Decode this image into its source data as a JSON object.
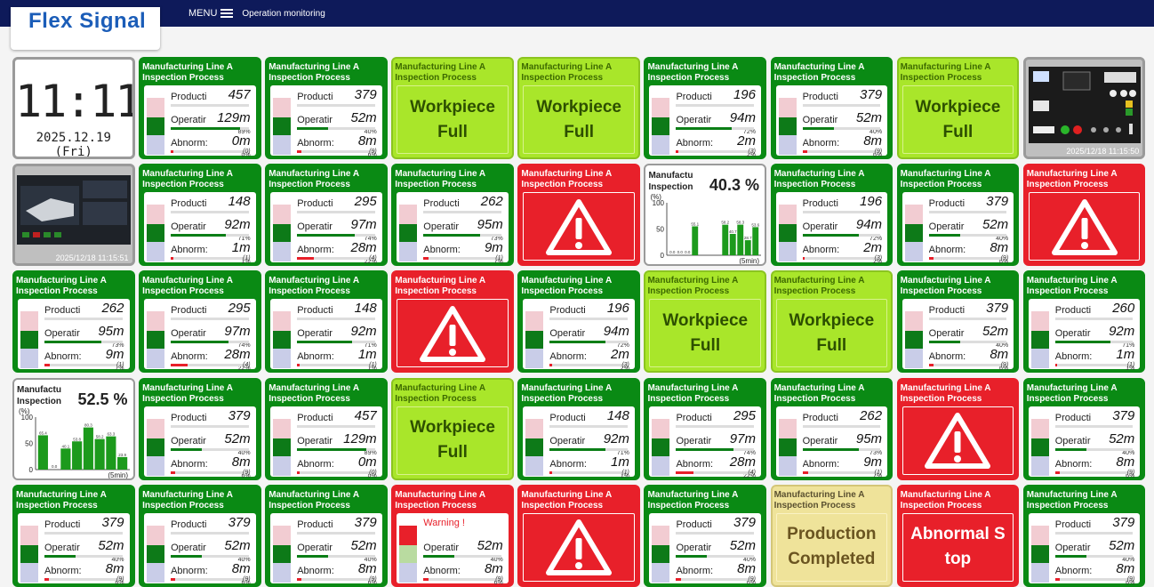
{
  "app": {
    "logo": "Flex Signal",
    "menu_label": "MENU",
    "breadcrumb": "Operation monitoring"
  },
  "clock": {
    "time": "11:11",
    "date": "2025.12.19 (Fri)"
  },
  "header": {
    "line1": "Manufacturing Line A",
    "line2": "Inspection Process"
  },
  "labels": {
    "production": "Producti",
    "operation": "Operatir",
    "abnormal": "Abnorm:",
    "warning": "Warning !"
  },
  "colors": {
    "green": "#0a8a14",
    "lime": "#a9e62a",
    "red": "#e8202a",
    "cream": "#efe39a",
    "navy": "#0e1a5a"
  },
  "tiles": [
    {
      "type": "clock"
    },
    {
      "type": "metric",
      "prod": "457",
      "op": "129m",
      "op_pct": "89%",
      "ab": "0m",
      "ab_pct": "0%",
      "count": "(0)",
      "op_fill": 0.89,
      "ab_fill": 0.0
    },
    {
      "type": "metric",
      "prod": "379",
      "op": "52m",
      "op_pct": "40%",
      "ab": "8m",
      "ab_pct": "6%",
      "count": "(9)",
      "op_fill": 0.4,
      "ab_fill": 0.06
    },
    {
      "type": "message",
      "color": "lime",
      "text": "Workpiece Full"
    },
    {
      "type": "message",
      "color": "lime",
      "text": "Workpiece Full"
    },
    {
      "type": "metric",
      "prod": "196",
      "op": "94m",
      "op_pct": "72%",
      "ab": "2m",
      "ab_pct": "2%",
      "count": "(3)",
      "op_fill": 0.72,
      "ab_fill": 0.02
    },
    {
      "type": "metric",
      "prod": "379",
      "op": "52m",
      "op_pct": "40%",
      "ab": "8m",
      "ab_pct": "6%",
      "count": "(9)",
      "op_fill": 0.4,
      "ab_fill": 0.06
    },
    {
      "type": "message",
      "color": "lime",
      "text": "Workpiece Full"
    },
    {
      "type": "image",
      "icon": "control-panel-image",
      "stamp": "2025/12/18 11:15:50"
    },
    {
      "type": "image",
      "icon": "machine-monitor-image",
      "stamp": "2025/12/18 11:15:51"
    },
    {
      "type": "metric",
      "prod": "148",
      "op": "92m",
      "op_pct": "71%",
      "ab": "1m",
      "ab_pct": "1%",
      "count": "(1)",
      "op_fill": 0.71,
      "ab_fill": 0.01
    },
    {
      "type": "metric",
      "prod": "295",
      "op": "97m",
      "op_pct": "74%",
      "ab": "28m",
      "ab_pct": "22%",
      "count": "(4)",
      "op_fill": 0.74,
      "ab_fill": 0.22
    },
    {
      "type": "metric",
      "prod": "262",
      "op": "95m",
      "op_pct": "73%",
      "ab": "9m",
      "ab_pct": "7%",
      "count": "(1)",
      "op_fill": 0.73,
      "ab_fill": 0.07
    },
    {
      "type": "alert"
    },
    {
      "type": "chart",
      "title": "Manufactu\nInspection",
      "big": "40.3 %",
      "unit": "(%)",
      "interval": "(5min)",
      "ymax": "100",
      "ymid": "50",
      "ymin": "0",
      "bars": [
        0,
        0,
        0,
        55.1,
        0,
        0,
        0,
        58.2,
        40.7,
        58.3,
        28.7,
        53.6
      ],
      "bar_labels": [
        "0.0",
        "0.0",
        "0.0",
        "55.1",
        "",
        "",
        "",
        "58.2",
        "40.7",
        "58.3",
        "28.7",
        "53.6"
      ]
    },
    {
      "type": "metric",
      "prod": "196",
      "op": "94m",
      "op_pct": "72%",
      "ab": "2m",
      "ab_pct": "2%",
      "count": "(3)",
      "op_fill": 0.72,
      "ab_fill": 0.02
    },
    {
      "type": "metric",
      "prod": "379",
      "op": "52m",
      "op_pct": "40%",
      "ab": "8m",
      "ab_pct": "6%",
      "count": "(9)",
      "op_fill": 0.4,
      "ab_fill": 0.06
    },
    {
      "type": "alert"
    },
    {
      "type": "metric",
      "prod": "262",
      "op": "95m",
      "op_pct": "73%",
      "ab": "9m",
      "ab_pct": "7%",
      "count": "(1)",
      "op_fill": 0.73,
      "ab_fill": 0.07
    },
    {
      "type": "metric",
      "prod": "295",
      "op": "97m",
      "op_pct": "74%",
      "ab": "28m",
      "ab_pct": "22%",
      "count": "(4)",
      "op_fill": 0.74,
      "ab_fill": 0.22
    },
    {
      "type": "metric",
      "prod": "148",
      "op": "92m",
      "op_pct": "71%",
      "ab": "1m",
      "ab_pct": "1%",
      "count": "(1)",
      "op_fill": 0.71,
      "ab_fill": 0.01
    },
    {
      "type": "alert"
    },
    {
      "type": "metric",
      "prod": "196",
      "op": "94m",
      "op_pct": "72%",
      "ab": "2m",
      "ab_pct": "2%",
      "count": "(3)",
      "op_fill": 0.72,
      "ab_fill": 0.02
    },
    {
      "type": "message",
      "color": "lime",
      "text": "Workpiece Full"
    },
    {
      "type": "message",
      "color": "lime",
      "text": "Workpiece Full"
    },
    {
      "type": "metric",
      "prod": "379",
      "op": "52m",
      "op_pct": "40%",
      "ab": "8m",
      "ab_pct": "6%",
      "count": "(9)",
      "op_fill": 0.4,
      "ab_fill": 0.06
    },
    {
      "type": "metric",
      "prod": "260",
      "op": "92m",
      "op_pct": "71%",
      "ab": "1m",
      "ab_pct": "1%",
      "count": "(1)",
      "op_fill": 0.71,
      "ab_fill": 0.01
    },
    {
      "type": "chart",
      "title": "Manufactu\nInspection",
      "big": "52.5 %",
      "unit": "(%)",
      "interval": "(5min)",
      "ymax": "100",
      "ymid": "50",
      "ymin": "0",
      "bars": [
        65.4,
        0,
        40.1,
        53.8,
        80.3,
        58.2,
        63.3,
        23.9
      ],
      "bar_labels": [
        "65.4",
        "0.0",
        "40.1",
        "53.8",
        "80.3",
        "58.2",
        "63.3",
        "23.9"
      ]
    },
    {
      "type": "metric",
      "prod": "379",
      "op": "52m",
      "op_pct": "40%",
      "ab": "8m",
      "ab_pct": "6%",
      "count": "(9)",
      "op_fill": 0.4,
      "ab_fill": 0.06
    },
    {
      "type": "metric",
      "prod": "457",
      "op": "129m",
      "op_pct": "89%",
      "ab": "0m",
      "ab_pct": "0%",
      "count": "(0)",
      "op_fill": 0.89,
      "ab_fill": 0.0
    },
    {
      "type": "message",
      "color": "lime",
      "text": "Workpiece Full"
    },
    {
      "type": "metric",
      "prod": "148",
      "op": "92m",
      "op_pct": "71%",
      "ab": "1m",
      "ab_pct": "1%",
      "count": "(1)",
      "op_fill": 0.71,
      "ab_fill": 0.01
    },
    {
      "type": "metric",
      "prod": "295",
      "op": "97m",
      "op_pct": "74%",
      "ab": "28m",
      "ab_pct": "22%",
      "count": "(4)",
      "op_fill": 0.74,
      "ab_fill": 0.22
    },
    {
      "type": "metric",
      "prod": "262",
      "op": "95m",
      "op_pct": "73%",
      "ab": "9m",
      "ab_pct": "7%",
      "count": "(1)",
      "op_fill": 0.73,
      "ab_fill": 0.07
    },
    {
      "type": "alert"
    },
    {
      "type": "metric",
      "prod": "379",
      "op": "52m",
      "op_pct": "40%",
      "ab": "8m",
      "ab_pct": "6%",
      "count": "(9)",
      "op_fill": 0.4,
      "ab_fill": 0.06
    },
    {
      "type": "metric",
      "prod": "379",
      "op": "52m",
      "op_pct": "40%",
      "ab": "8m",
      "ab_pct": "6%",
      "count": "(9)",
      "op_fill": 0.4,
      "ab_fill": 0.06
    },
    {
      "type": "metric",
      "prod": "379",
      "op": "52m",
      "op_pct": "40%",
      "ab": "8m",
      "ab_pct": "6%",
      "count": "(9)",
      "op_fill": 0.4,
      "ab_fill": 0.06
    },
    {
      "type": "metric",
      "prod": "379",
      "op": "52m",
      "op_pct": "40%",
      "ab": "8m",
      "ab_pct": "6%",
      "count": "(9)",
      "op_fill": 0.4,
      "ab_fill": 0.06
    },
    {
      "type": "warn",
      "op": "52m",
      "op_pct": "40%",
      "ab": "8m",
      "ab_pct": "6%",
      "count": "(9)",
      "op_fill": 0.4,
      "ab_fill": 0.06
    },
    {
      "type": "alert"
    },
    {
      "type": "metric",
      "prod": "379",
      "op": "52m",
      "op_pct": "40%",
      "ab": "8m",
      "ab_pct": "6%",
      "count": "(9)",
      "op_fill": 0.4,
      "ab_fill": 0.06
    },
    {
      "type": "message",
      "color": "cream",
      "text": "Production Completed"
    },
    {
      "type": "message",
      "color": "red",
      "text": "Abnormal Stop"
    },
    {
      "type": "metric",
      "prod": "379",
      "op": "52m",
      "op_pct": "40%",
      "ab": "8m",
      "ab_pct": "6%",
      "count": "(9)",
      "op_fill": 0.4,
      "ab_fill": 0.06
    }
  ]
}
